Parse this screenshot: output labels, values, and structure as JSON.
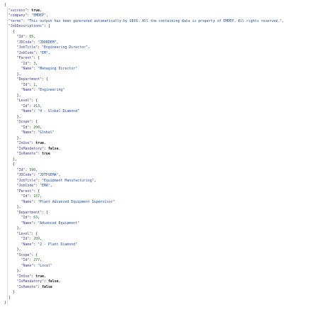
{
  "json_text": [
    "{",
    "  \"success\": true,",
    "  \"company\": \"EMDEP\",",
    "  \"terms\": \"This output has been generated automatically by GEOS. All the containing data is property of EMDEP. All rights reserved.\",",
    "  \"JobDescriptions\": [",
    "    {",
    "      \"Id\": 65,",
    "      \"JDCode\": \"JDDRDEM\",",
    "      \"JobTitle\": \"Engineering Director\",",
    "      \"JobCode\": \"EM\",",
    "      \"Parent\": {",
    "        \"Id\": 3,",
    "        \"Name\": \"Managing Director\"",
    "      },",
    "      \"Department\": {",
    "        \"Id\": 1,",
    "        \"Name\": \"Engineering\"",
    "      },",
    "      \"Level\": {",
    "        \"Id\": 213,",
    "        \"Name\": \"4 - Global Diamond\"",
    "      },",
    "      \"Scope\": {",
    "        \"Id\": 200,",
    "        \"Name\": \"Global\"",
    "      },",
    "      \"InUse\": true,",
    "      \"IsMandatory\": false,",
    "      \"IsRemote\": true",
    "    },",
    "    {",
    "      \"Id\": 590,",
    "      \"JDCode\": \"JDTPSEMA\",",
    "      \"JobTitle\": \"Equipment Manufacturing\",",
    "      \"JobCode\": \"EMA\",",
    "      \"Parent\": {",
    "        \"Id\": 157,",
    "        \"Name\": \"Plant Advanced Equipment Supervisor\"",
    "      },",
    "      \"Department\": {",
    "        \"Id\": 63,",
    "        \"Name\": \"Advanced Equipment\"",
    "      },",
    "      \"Level\": {",
    "        \"Id\": 209,",
    "        \"Name\": \"2 - Plant Diamond\"",
    "      },",
    "      \"Scope\": {",
    "        \"Id\": 277,",
    "        \"Name\": \"Local\"",
    "      },",
    "      \"InUse\": true,",
    "      \"IsMandatory\": false,",
    "      \"IsRemote\": false",
    "    }",
    "  ]",
    "}"
  ]
}
